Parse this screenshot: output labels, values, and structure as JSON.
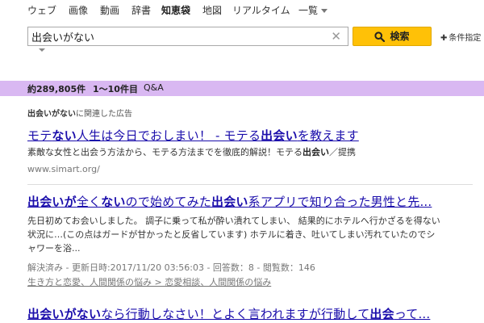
{
  "nav": {
    "items": [
      "ウェブ",
      "画像",
      "動画",
      "辞書",
      "知恵袋",
      "地図",
      "リアルタイム",
      "一覧"
    ],
    "active_index": 4
  },
  "search": {
    "query": "出会いがない",
    "button_label": "検索",
    "options_label": "条件指定"
  },
  "results_bar": {
    "count": "約289,805件",
    "range": "1～10件目",
    "qa": "Q&A"
  },
  "ad": {
    "header": [
      {
        "t": "出会いがない",
        "b": true
      },
      {
        "t": "に関連した広告",
        "b": false
      }
    ],
    "title": [
      {
        "t": "モテ",
        "b": false
      },
      {
        "t": "ない",
        "b": true
      },
      {
        "t": "人生は今日でおしまい！ - モテる",
        "b": false
      },
      {
        "t": "出会い",
        "b": true
      },
      {
        "t": "を教えます",
        "b": false
      }
    ],
    "snippet": [
      {
        "t": "素敵な女性と出会う方法から、モテる方法までを徹底的解説！モテる",
        "b": false
      },
      {
        "t": "出会い",
        "b": true
      },
      {
        "t": "／提携",
        "b": false
      }
    ],
    "url": "www.simart.org/"
  },
  "results": [
    {
      "title": [
        {
          "t": "出会いが",
          "b": true
        },
        {
          "t": "全く",
          "b": false
        },
        {
          "t": "ない",
          "b": true
        },
        {
          "t": "ので始めてみた",
          "b": false
        },
        {
          "t": "出会い",
          "b": true
        },
        {
          "t": "系アプリで知り合った男性と先...",
          "b": false
        }
      ],
      "snippet": [
        "先日初めてお会いしました。 調子に乗って私が酔い潰れてしまい、 結果的にホテルへ行かざるを得ない",
        "状況に…(この点はガードが甘かったと反省しています) ホテルに着き、吐いてしまい汚れていたのでシ",
        "ャワーを浴..."
      ],
      "meta": "解決済み - 更新日時:2017/11/20 03:56:03 - 回答数：8 - 閲覧数：146",
      "categories": "生き方と恋愛、人間関係の悩み > 恋愛相談、人間関係の悩み"
    },
    {
      "title": [
        {
          "t": "出会いがない",
          "b": true
        },
        {
          "t": "なら行動しなさい！とよく言われますが行動して",
          "b": false
        },
        {
          "t": "出会",
          "b": true
        },
        {
          "t": "って...",
          "b": false
        }
      ]
    }
  ]
}
